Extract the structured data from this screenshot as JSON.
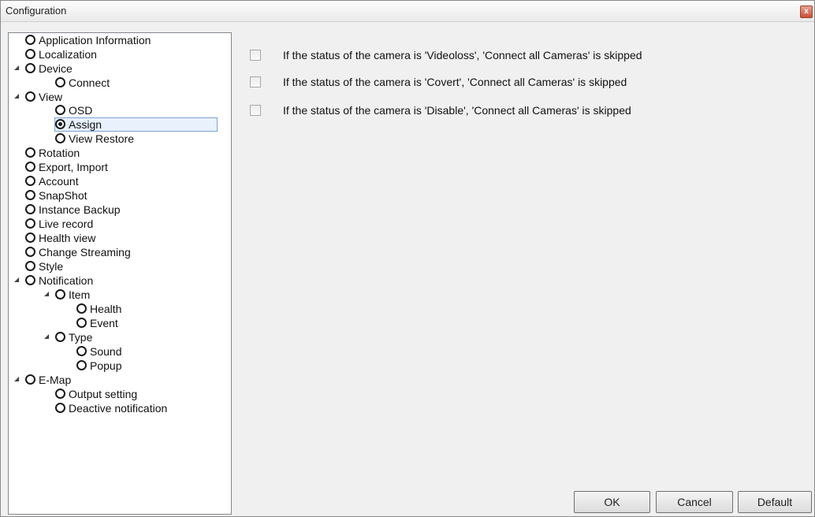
{
  "window": {
    "title": "Configuration",
    "close_glyph": "x"
  },
  "tree": {
    "items": [
      {
        "label": "Application Information"
      },
      {
        "label": "Localization"
      },
      {
        "label": "Device",
        "expanded": true
      },
      {
        "label": "Connect"
      },
      {
        "label": "View",
        "expanded": true
      },
      {
        "label": "OSD"
      },
      {
        "label": "Assign",
        "selected": true
      },
      {
        "label": "View Restore"
      },
      {
        "label": "Rotation"
      },
      {
        "label": "Export, Import"
      },
      {
        "label": "Account"
      },
      {
        "label": "SnapShot"
      },
      {
        "label": "Instance Backup"
      },
      {
        "label": "Live record"
      },
      {
        "label": "Health view"
      },
      {
        "label": "Change Streaming"
      },
      {
        "label": "Style"
      },
      {
        "label": "Notification",
        "expanded": true
      },
      {
        "label": "Item",
        "expanded": true
      },
      {
        "label": "Health"
      },
      {
        "label": "Event"
      },
      {
        "label": "Type",
        "expanded": true
      },
      {
        "label": "Sound"
      },
      {
        "label": "Popup"
      },
      {
        "label": "E-Map",
        "expanded": true
      },
      {
        "label": "Output setting"
      },
      {
        "label": "Deactive notification"
      }
    ],
    "expander_glyph": "◢"
  },
  "options": [
    {
      "label": "If the status of the camera is 'Videoloss', 'Connect all Cameras' is skipped",
      "checked": false
    },
    {
      "label": "If the status of the camera is 'Covert', 'Connect all Cameras' is skipped",
      "checked": false
    },
    {
      "label": "If the status of the camera is 'Disable', 'Connect all Cameras' is skipped",
      "checked": false
    }
  ],
  "buttons": {
    "ok": "OK",
    "cancel": "Cancel",
    "default": "Default"
  }
}
